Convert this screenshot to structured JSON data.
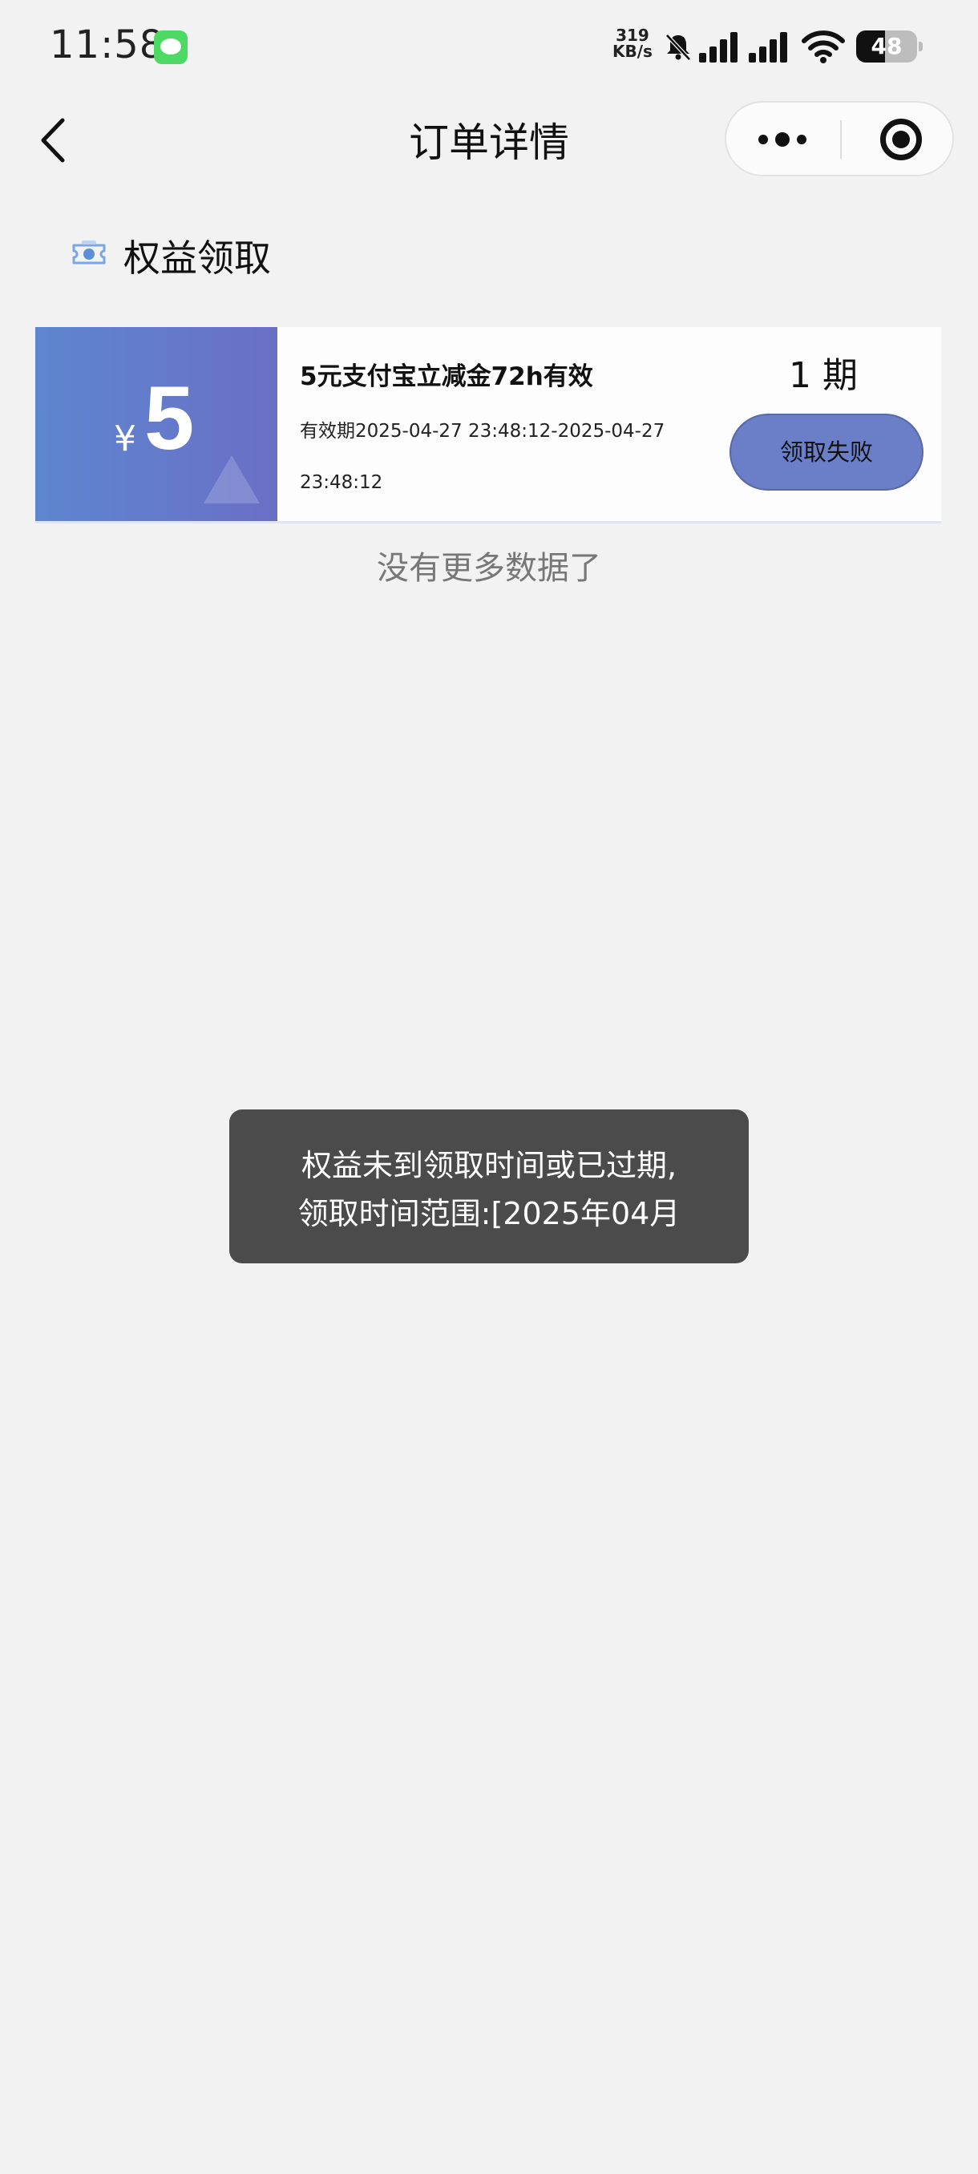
{
  "status_bar": {
    "time": "11:58",
    "net_speed_value": "319",
    "net_speed_unit": "KB/s",
    "battery": "48",
    "battery_level": 0.48
  },
  "nav": {
    "title": "订单详情",
    "icons": {
      "back": "chevron-left-icon",
      "more": "more-dots-icon",
      "close": "target-circle-icon"
    }
  },
  "section": {
    "title": "权益领取",
    "icon": "gift-ticket-icon"
  },
  "coupon": {
    "currency": "¥",
    "amount": "5",
    "title": "5元支付宝立减金72h有效",
    "validity": "有效期2025-04-27 23:48:12-2025-04-27 23:48:12",
    "period": "1 期",
    "claim_label": "领取失败",
    "colors": {
      "left_gradient_start": "#5d86cf",
      "left_gradient_end": "#6a6fc6",
      "button": "#6a7fc8"
    }
  },
  "list_footer": "没有更多数据了",
  "toast": {
    "line1": "权益未到领取时间或已过期,",
    "line2": "领取时间范围:[2025年04月"
  }
}
